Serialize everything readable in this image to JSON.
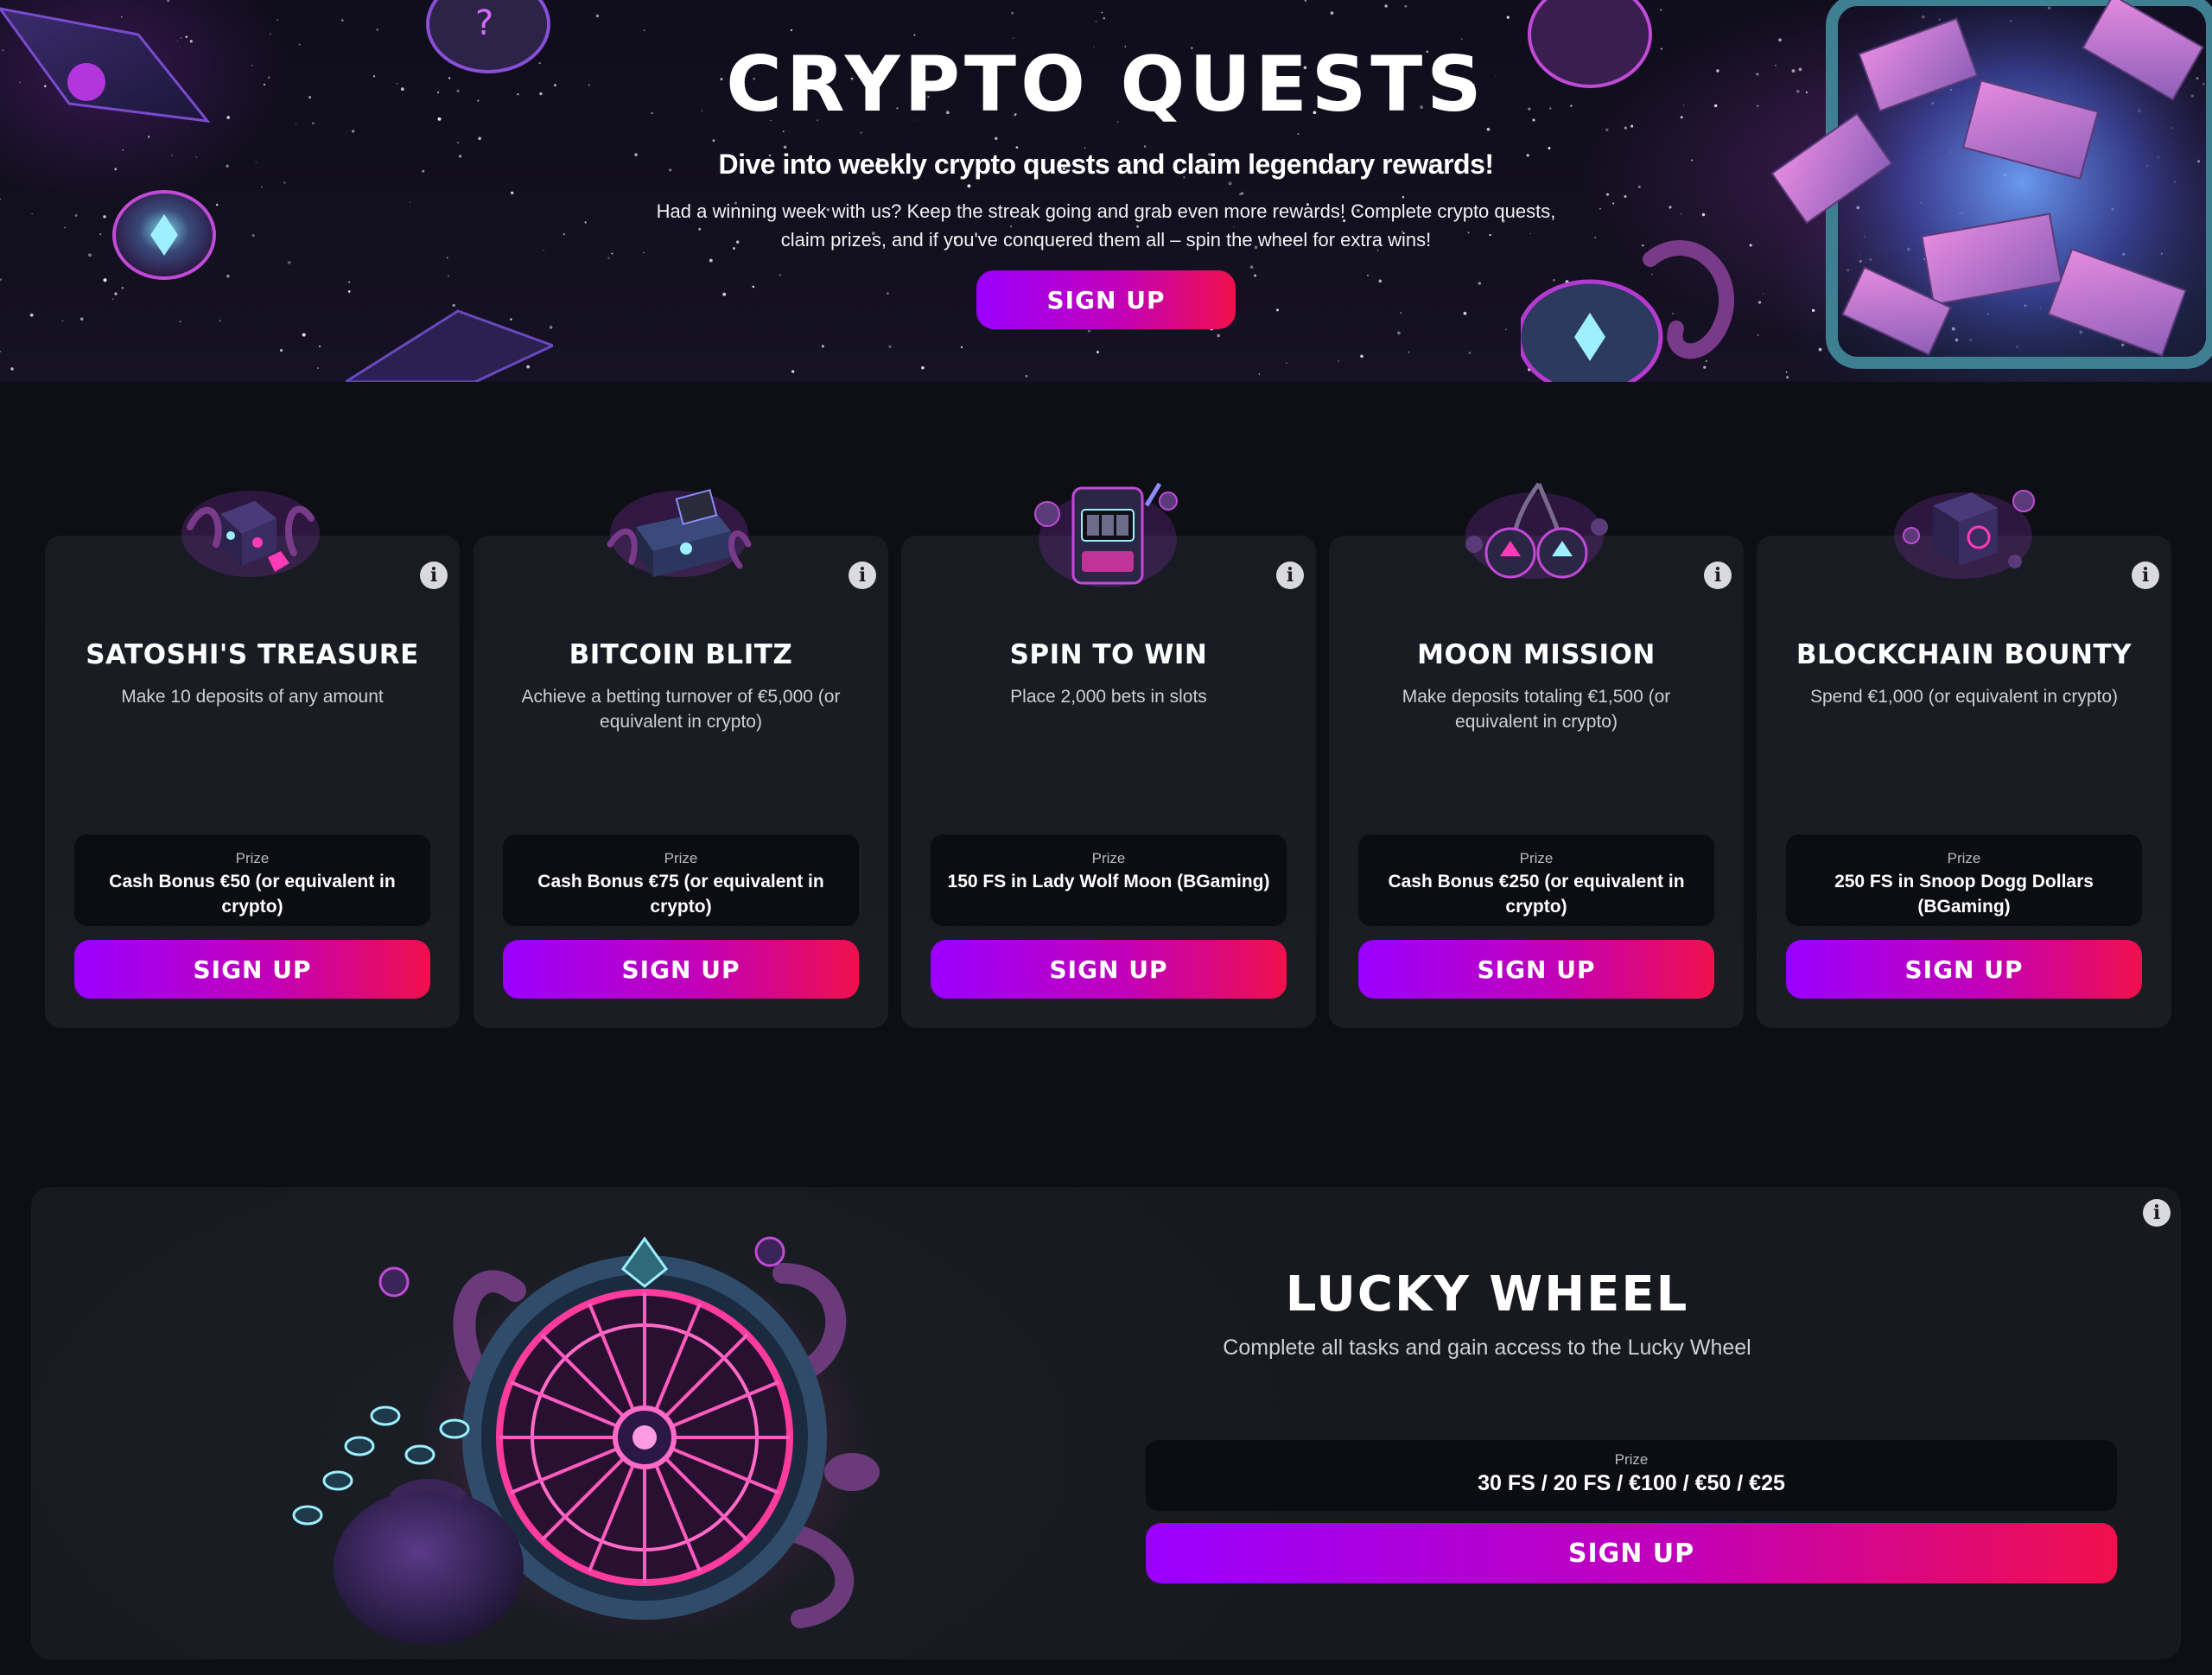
{
  "hero": {
    "title": "CRYPTO QUESTS",
    "subtitle": "Dive into weekly crypto quests and claim legendary rewards!",
    "text": "Had a winning week with us? Keep the streak going and grab even more rewards! Complete crypto quests, claim prizes, and if you've conquered them all – spin the wheel for extra wins!",
    "button": "SIGN UP"
  },
  "quests": [
    {
      "title": "SATOSHI'S TREASURE",
      "description": "Make 10 deposits of any amount",
      "prize_label": "Prize",
      "prize": "Cash Bonus €50 (or equivalent in crypto)",
      "button": "SIGN UP",
      "icon": "treasure-dice-icon"
    },
    {
      "title": "BITCOIN BLITZ",
      "description": "Achieve a betting turnover of €5,000 (or equivalent in crypto)",
      "prize_label": "Prize",
      "prize": "Cash Bonus €75 (or equivalent in crypto)",
      "button": "SIGN UP",
      "icon": "treasure-chest-icon"
    },
    {
      "title": "SPIN TO WIN",
      "description": "Place 2,000 bets in slots",
      "prize_label": "Prize",
      "prize": "150 FS in Lady Wolf Moon (BGaming)",
      "button": "SIGN UP",
      "icon": "slot-machine-icon"
    },
    {
      "title": "MOON MISSION",
      "description": "Make deposits totaling €1,500 (or equivalent in crypto)",
      "prize_label": "Prize",
      "prize": "Cash Bonus €250 (or equivalent in crypto)",
      "button": "SIGN UP",
      "icon": "cherries-icon"
    },
    {
      "title": "BLOCKCHAIN BOUNTY",
      "description": "Spend €1,000 (or equivalent in crypto)",
      "prize_label": "Prize",
      "prize": "250 FS in Snoop Dogg Dollars (BGaming)",
      "button": "SIGN UP",
      "icon": "crypto-cube-icon"
    }
  ],
  "lucky_wheel": {
    "title": "LUCKY WHEEL",
    "description": "Complete all tasks and gain access to the Lucky Wheel",
    "prize_label": "Prize",
    "prize": "30 FS / 20 FS / €100 / €50 / €25",
    "button": "SIGN UP",
    "icon": "lucky-wheel-icon"
  },
  "info_icon": "i",
  "colors": {
    "page_bg": "#0d0f15",
    "card_bg": "#1b1d23",
    "prize_bg": "#0c0d12",
    "button_start": "#9a00ff",
    "button_end": "#f0104d"
  }
}
